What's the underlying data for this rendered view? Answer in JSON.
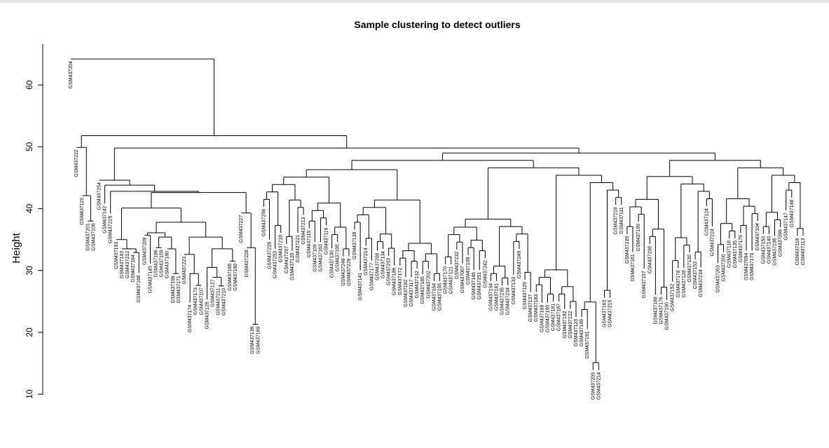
{
  "chart_data": {
    "type": "dendrogram",
    "title": "Sample clustering to detect outliers",
    "xlabel": "",
    "ylabel": "Height",
    "ylim": [
      9,
      67
    ],
    "yticks": [
      10,
      20,
      30,
      40,
      50,
      60
    ],
    "grid": false,
    "leaves": [
      {
        "label": "GSM437204",
        "height": 64.2
      },
      {
        "label": "GSM437222",
        "height": 49.9
      },
      {
        "label": "GSM437119",
        "height": 42.1
      },
      {
        "label": "GSM437201",
        "height": 38.0
      },
      {
        "label": "GSM437106",
        "height": 38.0
      },
      {
        "label": "GSM437254",
        "height": 44.6
      },
      {
        "label": "GSM437142",
        "height": 40.8
      },
      {
        "label": "GSM437225",
        "height": 39.2
      },
      {
        "label": "GSM437193",
        "height": 35.0
      },
      {
        "label": "GSM437143",
        "height": 33.5
      },
      {
        "label": "GSM437212",
        "height": 33.5
      },
      {
        "label": "GSM437184",
        "height": 32.9
      },
      {
        "label": "GSM437166",
        "height": 29.6
      },
      {
        "label": "GSM437209",
        "height": 35.7
      },
      {
        "label": "GSM437145",
        "height": 31.1
      },
      {
        "label": "GSM437196",
        "height": 33.7
      },
      {
        "label": "GSM437159",
        "height": 33.7
      },
      {
        "label": "GSM437180",
        "height": 33.5
      },
      {
        "label": "GSM437198",
        "height": 29.5
      },
      {
        "label": "GSM437171",
        "height": 29.5
      },
      {
        "label": "GSM437223",
        "height": 32.6
      },
      {
        "label": "GSM437174",
        "height": 24.8
      },
      {
        "label": "GSM437173",
        "height": 27.6
      },
      {
        "label": "GSM437107",
        "height": 27.6
      },
      {
        "label": "GSM437126",
        "height": 25.3
      },
      {
        "label": "GSM437127",
        "height": 28.9
      },
      {
        "label": "GSM437211",
        "height": 27.5
      },
      {
        "label": "GSM437210",
        "height": 27.5
      },
      {
        "label": "GSM437165",
        "height": 31.5
      },
      {
        "label": "GSM437160",
        "height": 31.5
      },
      {
        "label": "GSM437227",
        "height": 39.3
      },
      {
        "label": "GSM437228",
        "height": 33.7
      },
      {
        "label": "GSM437139",
        "height": 21.3
      },
      {
        "label": "GSM437169",
        "height": 21.3
      },
      {
        "label": "GSM437256",
        "height": 40.3
      },
      {
        "label": "GSM437226",
        "height": 35.0
      },
      {
        "label": "GSM437253",
        "height": 33.5
      },
      {
        "label": "GSM437218",
        "height": 36.1
      },
      {
        "label": "GSM437207",
        "height": 34.3
      },
      {
        "label": "GSM437120",
        "height": 33.2
      },
      {
        "label": "GSM437221",
        "height": 36.1
      },
      {
        "label": "GSM437213",
        "height": 39.0
      },
      {
        "label": "GSM437115",
        "height": 36.8
      },
      {
        "label": "GSM437109",
        "height": 34.6
      },
      {
        "label": "GSM437163",
        "height": 34.6
      },
      {
        "label": "GSM437116",
        "height": 37.3
      },
      {
        "label": "GSM437130",
        "height": 33.6
      },
      {
        "label": "GSM437195",
        "height": 34.6
      },
      {
        "label": "GSM437248",
        "height": 32.3
      },
      {
        "label": "GSM437229",
        "height": 32.3
      },
      {
        "label": "GSM437138",
        "height": 36.6
      },
      {
        "label": "GSM437141",
        "height": 30.0
      },
      {
        "label": "GSM437214",
        "height": 34.0
      },
      {
        "label": "GSM437177",
        "height": 31.6
      },
      {
        "label": "GSM437208",
        "height": 33.2
      },
      {
        "label": "GSM437134",
        "height": 33.5
      },
      {
        "label": "GSM437203",
        "height": 32.4
      },
      {
        "label": "GSM437186",
        "height": 30.8
      },
      {
        "label": "GSM437172",
        "height": 30.8
      },
      {
        "label": "GSM437182",
        "height": 28.9
      },
      {
        "label": "GSM437117",
        "height": 28.9
      },
      {
        "label": "GSM437132",
        "height": 30.3
      },
      {
        "label": "GSM437185",
        "height": 29.4
      },
      {
        "label": "GSM437202",
        "height": 30.3
      },
      {
        "label": "GSM437164",
        "height": 28.3
      },
      {
        "label": "GSM437155",
        "height": 28.3
      },
      {
        "label": "GSM437170",
        "height": 31.0
      },
      {
        "label": "GSM437121",
        "height": 31.0
      },
      {
        "label": "GSM437232",
        "height": 33.4
      },
      {
        "label": "GSM437067",
        "height": 31.1
      },
      {
        "label": "GSM437108",
        "height": 32.5
      },
      {
        "label": "GSM437146",
        "height": 30.1
      },
      {
        "label": "GSM437251",
        "height": 30.1
      },
      {
        "label": "GSM437242",
        "height": 32.0
      },
      {
        "label": "GSM437194",
        "height": 28.3
      },
      {
        "label": "GSM437181",
        "height": 28.3
      },
      {
        "label": "GSM437235",
        "height": 27.6
      },
      {
        "label": "GSM437234",
        "height": 27.6
      },
      {
        "label": "GSM437133",
        "height": 29.3
      },
      {
        "label": "GSM437249",
        "height": 33.5
      },
      {
        "label": "GSM437129",
        "height": 28.5
      },
      {
        "label": "GSM437137",
        "height": 26.5
      },
      {
        "label": "GSM437183",
        "height": 26.5
      },
      {
        "label": "GSM437168",
        "height": 24.8
      },
      {
        "label": "GSM437100",
        "height": 24.8
      },
      {
        "label": "GSM437181",
        "height": 25.0
      },
      {
        "label": "GSM437187",
        "height": 25.0
      },
      {
        "label": "GSM437192",
        "height": 23.8
      },
      {
        "label": "GSM437122",
        "height": 23.8
      },
      {
        "label": "GSM437123",
        "height": 22.5
      },
      {
        "label": "GSM437189",
        "height": 22.5
      },
      {
        "label": "GSM437191",
        "height": 20.5
      },
      {
        "label": "GSM437205",
        "height": 13.9
      },
      {
        "label": "GSM437214",
        "height": 13.9
      },
      {
        "label": "GSM437163",
        "height": 25.6
      },
      {
        "label": "GSM437215",
        "height": 25.6
      },
      {
        "label": "GSM437219",
        "height": 40.6
      },
      {
        "label": "GSM437111",
        "height": 40.6
      },
      {
        "label": "GSM437220",
        "height": 35.9
      },
      {
        "label": "GSM437161",
        "height": 33.0
      },
      {
        "label": "GSM437199",
        "height": 37.9
      },
      {
        "label": "GSM437157",
        "height": 30.3
      },
      {
        "label": "GSM437206",
        "height": 34.3
      },
      {
        "label": "GSM437188",
        "height": 26.1
      },
      {
        "label": "GSM437176",
        "height": 26.1
      },
      {
        "label": "GSM437190",
        "height": 25.2
      },
      {
        "label": "GSM437152",
        "height": 28.2
      },
      {
        "label": "GSM437178",
        "height": 30.4
      },
      {
        "label": "GSM437128",
        "height": 30.4
      },
      {
        "label": "GSM437130",
        "height": 32.9
      },
      {
        "label": "GSM437153",
        "height": 31.8
      },
      {
        "label": "GSM437234",
        "height": 30.5
      },
      {
        "label": "GSM437124",
        "height": 40.4
      },
      {
        "label": "GSM437224",
        "height": 37.1
      },
      {
        "label": "GSM437263",
        "height": 31.2
      },
      {
        "label": "GSM437200",
        "height": 33.0
      },
      {
        "label": "GSM437118",
        "height": 35.2
      },
      {
        "label": "GSM437135",
        "height": 35.2
      },
      {
        "label": "GSM437176",
        "height": 36.1
      },
      {
        "label": "GSM437094",
        "height": 33.2
      },
      {
        "label": "GSM437175",
        "height": 33.2
      },
      {
        "label": "GSM437104",
        "height": 38.0
      },
      {
        "label": "GSM437150",
        "height": 35.9
      },
      {
        "label": "GSM437140",
        "height": 35.9
      },
      {
        "label": "GSM437236",
        "height": 35.6
      },
      {
        "label": "GSM437099",
        "height": 37.0
      },
      {
        "label": "GSM437147",
        "height": 39.7
      },
      {
        "label": "GSM437148",
        "height": 41.8
      },
      {
        "label": "GSM437118",
        "height": 35.6
      },
      {
        "label": "GSM437113",
        "height": 35.6
      }
    ],
    "merges": [
      {
        "left": 3,
        "right": 4,
        "height": 38.0
      },
      {
        "left": 2,
        "right": "m0",
        "height": 42.1
      },
      {
        "left": 1,
        "right": "m1",
        "height": 49.9
      },
      {
        "left": 11,
        "right": 12,
        "height": 32.9
      },
      {
        "left": 10,
        "right": "m3",
        "height": 33.5
      },
      {
        "left": 9,
        "right": "m4",
        "height": 33.5
      },
      {
        "left": 8,
        "right": "m5",
        "height": 35.0
      },
      {
        "left": 18,
        "right": 19,
        "height": 29.5
      },
      {
        "left": 17,
        "right": "m7",
        "height": 33.5
      },
      {
        "left": 15,
        "right": 16,
        "height": 33.7
      },
      {
        "left": "m8",
        "right": "m9",
        "height": 35.4
      },
      {
        "left": 13,
        "right": 14,
        "height": 35.7
      },
      {
        "left": "m11",
        "right": "m10",
        "height": 36.1
      },
      {
        "left": 22,
        "right": 23,
        "height": 27.6
      },
      {
        "left": 21,
        "right": "m13",
        "height": 29.5
      },
      {
        "left": 20,
        "right": "m14",
        "height": 32.6
      },
      {
        "left": 26,
        "right": 27,
        "height": 27.5
      },
      {
        "left": 25,
        "right": "m16",
        "height": 28.9
      },
      {
        "left": 24,
        "right": "m17",
        "height": 30.5
      },
      {
        "left": 28,
        "right": 29,
        "height": 31.5
      },
      {
        "left": "m18",
        "right": "m19",
        "height": 33.5
      },
      {
        "left": "m15",
        "right": "m20",
        "height": 35.4
      },
      {
        "left": "m12",
        "right": "m21",
        "height": 37.8
      },
      {
        "left": "m6",
        "right": "m22",
        "height": 40.1
      },
      {
        "left": 32,
        "right": 33,
        "height": 21.3
      },
      {
        "left": 31,
        "right": "m24",
        "height": 33.7
      },
      {
        "left": 30,
        "right": "m25",
        "height": 39.3
      },
      {
        "left": "m23",
        "right": "m26",
        "height": 42.6
      },
      {
        "left": 7,
        "right": "m27",
        "height": 42.8
      },
      {
        "left": 6,
        "right": "m28",
        "height": 43.8
      },
      {
        "left": 5,
        "right": "m29",
        "height": 44.6
      }
    ]
  }
}
